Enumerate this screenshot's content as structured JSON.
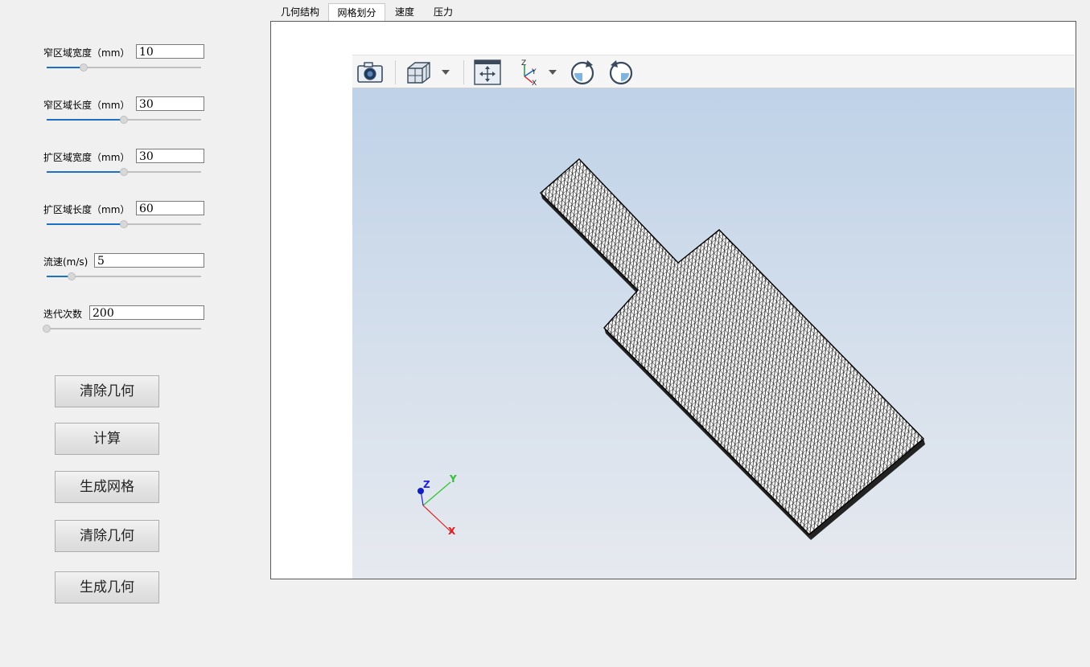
{
  "params": [
    {
      "label": "窄区域宽度（mm）",
      "value": "10",
      "slider": 0.24
    },
    {
      "label": "窄区域长度（mm）",
      "value": "30",
      "slider": 0.5
    },
    {
      "label": "扩区域宽度（mm）",
      "value": "30",
      "slider": 0.5
    },
    {
      "label": "扩区域长度（mm）",
      "value": "60",
      "slider": 0.5
    },
    {
      "label": "流速(m/s)",
      "value": "5",
      "slider": 0.16
    },
    {
      "label": "迭代次数",
      "value": "200",
      "slider": 0.0
    }
  ],
  "buttons": [
    "清除几何",
    "计算",
    "生成网格",
    "清除几何",
    "生成几何"
  ],
  "tabs": [
    {
      "label": "几何结构",
      "active": false
    },
    {
      "label": "网格划分",
      "active": true
    },
    {
      "label": "速度",
      "active": false
    },
    {
      "label": "压力",
      "active": false
    }
  ],
  "toolbar": {
    "icons": [
      "camera-icon",
      "view-cube-icon",
      "dropdown-arrow-icon",
      "fit-view-icon",
      "axes-orientation-icon",
      "dropdown-arrow-icon",
      "rotate-clockwise-icon",
      "rotate-counterclockwise-icon"
    ],
    "axis_icon_labels": {
      "z": "Z",
      "y": "Y",
      "x": "X"
    }
  },
  "triad": {
    "z": "Z",
    "y": "Y",
    "x": "X"
  },
  "colors": {
    "slider_fill": "#1f6fc5",
    "mesh_stroke": "#000000",
    "axis_x": "#e02020",
    "axis_y": "#20c020",
    "axis_z": "#1010e0"
  }
}
